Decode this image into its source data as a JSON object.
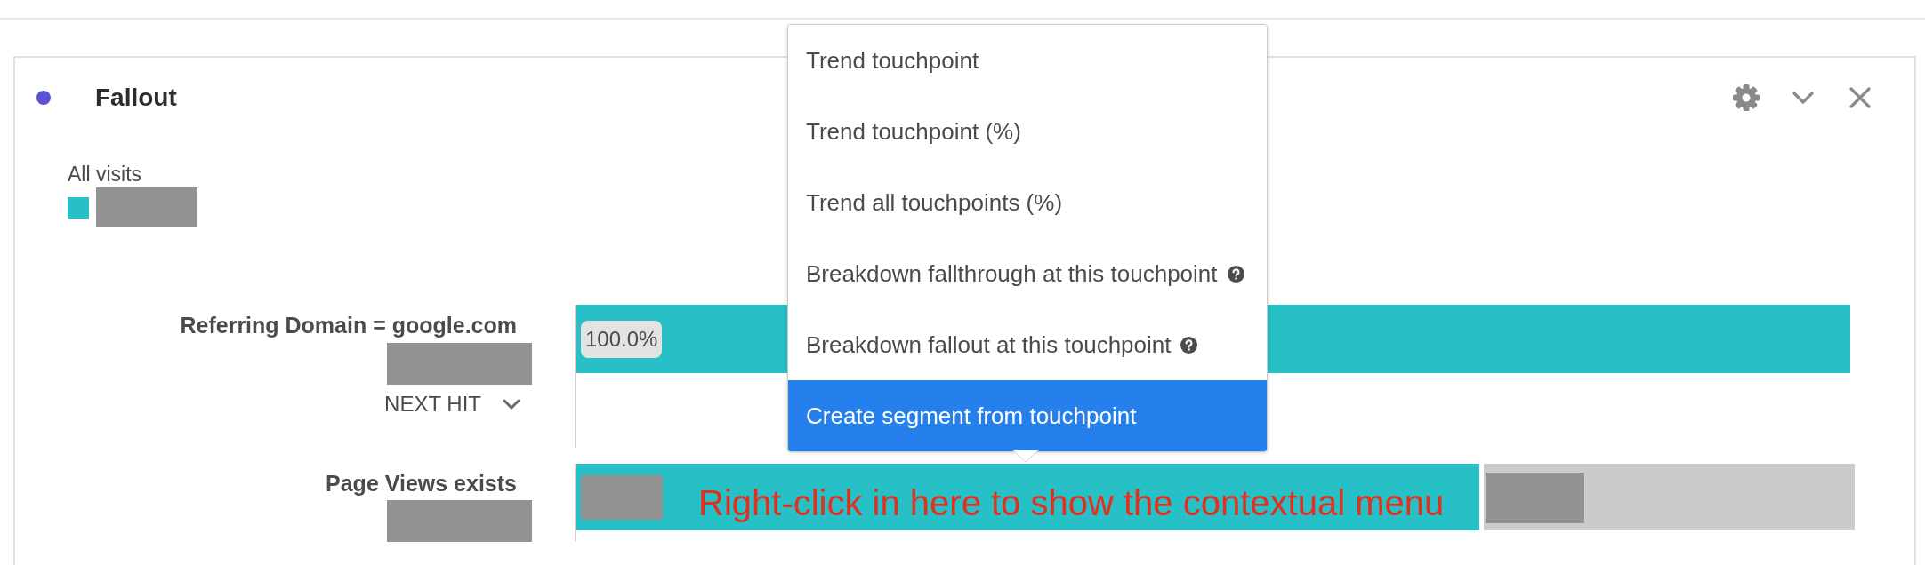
{
  "panel": {
    "title": "Fallout",
    "legend": {
      "label": "All visits"
    }
  },
  "steps": [
    {
      "label": "Referring Domain = google.com",
      "level": 1,
      "reading": "100.0%",
      "connector": "NEXT HIT"
    },
    {
      "label": "Page Views exists",
      "level": 0.71,
      "annotation": "Right-click in here to show the contextual menu"
    }
  ],
  "context_menu": {
    "items": [
      {
        "label": "Trend touchpoint",
        "selected": false,
        "help": false
      },
      {
        "label": "Trend touchpoint (%)",
        "selected": false,
        "help": false
      },
      {
        "label": "Trend all touchpoints (%)",
        "selected": false,
        "help": false
      },
      {
        "label": "Breakdown fallthrough at this touchpoint",
        "selected": false,
        "help": true
      },
      {
        "label": "Breakdown fallout at this touchpoint",
        "selected": false,
        "help": true
      },
      {
        "label": "Create segment from touchpoint",
        "selected": true,
        "help": false
      }
    ]
  }
}
